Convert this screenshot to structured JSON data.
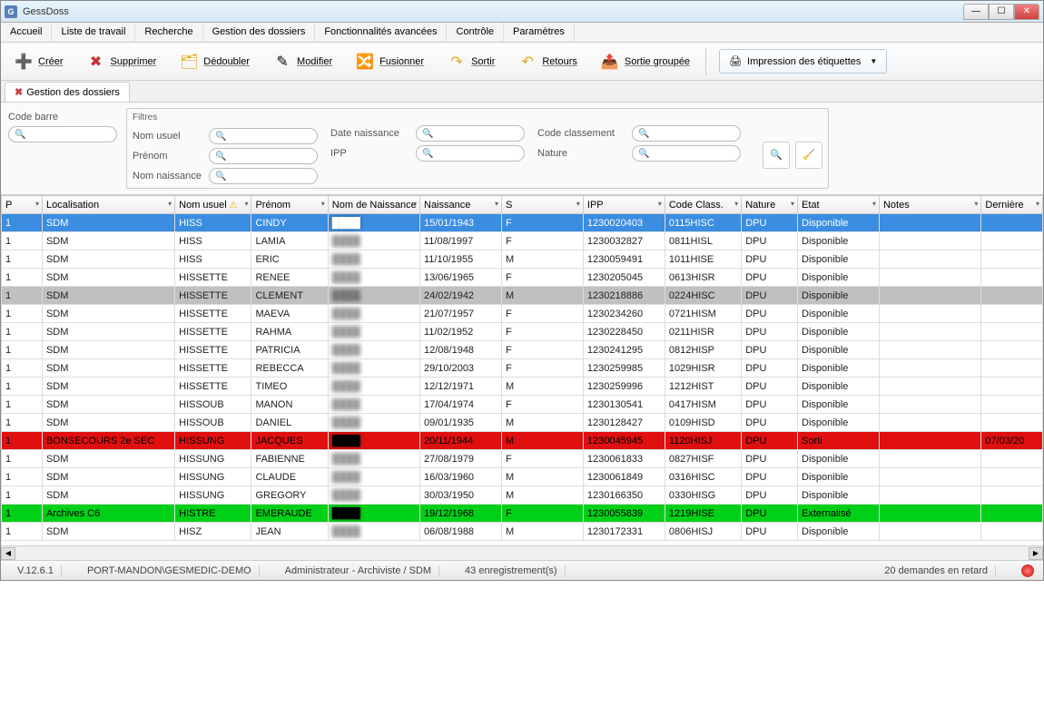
{
  "window": {
    "title": "GessDoss"
  },
  "menu": [
    "Accueil",
    "Liste de travail",
    "Recherche",
    "Gestion des dossiers",
    "Fonctionnalités avancées",
    "Contrôle",
    "Paramètres"
  ],
  "toolbar": {
    "creer": "Créer",
    "supprimer": "Supprimer",
    "dedoubler": "Dédoubler",
    "modifier": "Modifier",
    "fusionner": "Fusionner",
    "sortir": "Sortir",
    "retours": "Retours",
    "sortie_groupee": "Sortie groupée",
    "impression": "Impression des étiquettes"
  },
  "tab": {
    "label": "Gestion des dossiers"
  },
  "filters": {
    "code_barre_label": "Code barre",
    "filtres_label": "Filtres",
    "nom_usuel_label": "Nom usuel",
    "prenom_label": "Prénom",
    "nom_naissance_label": "Nom naissance",
    "date_naissance_label": "Date naissance",
    "ipp_label": "IPP",
    "code_classement_label": "Code classement",
    "nature_label": "Nature"
  },
  "columns": [
    "P",
    "Localisation",
    "Nom usuel",
    "Prénom",
    "Nom de Naissance",
    "Naissance",
    "S",
    "IPP",
    "Code Class.",
    "Nature",
    "Etat",
    "Notes",
    "Dernière"
  ],
  "rows": [
    {
      "p": "1",
      "loc": "SDM",
      "nom": "HISS",
      "prenom": "CINDY",
      "nomn": "",
      "naiss": "15/01/1943",
      "s": "F",
      "ipp": "1230020403",
      "cc": "0115HISC",
      "nat": "DPU",
      "etat": "Disponible",
      "notes": "",
      "dern": "",
      "cls": "row-selected"
    },
    {
      "p": "1",
      "loc": "SDM",
      "nom": "HISS",
      "prenom": "LAMIA",
      "nomn": "",
      "naiss": "11/08/1997",
      "s": "F",
      "ipp": "1230032827",
      "cc": "0811HISL",
      "nat": "DPU",
      "etat": "Disponible",
      "notes": "",
      "dern": "",
      "cls": ""
    },
    {
      "p": "1",
      "loc": "SDM",
      "nom": "HISS",
      "prenom": "ERIC",
      "nomn": "",
      "naiss": "11/10/1955",
      "s": "M",
      "ipp": "1230059491",
      "cc": "1011HISE",
      "nat": "DPU",
      "etat": "Disponible",
      "notes": "",
      "dern": "",
      "cls": ""
    },
    {
      "p": "1",
      "loc": "SDM",
      "nom": "HISSETTE",
      "prenom": "RENEE",
      "nomn": "",
      "naiss": "13/06/1965",
      "s": "F",
      "ipp": "1230205045",
      "cc": "0613HISR",
      "nat": "DPU",
      "etat": "Disponible",
      "notes": "",
      "dern": "",
      "cls": ""
    },
    {
      "p": "1",
      "loc": "SDM",
      "nom": "HISSETTE",
      "prenom": "CLEMENT",
      "nomn": "",
      "naiss": "24/02/1942",
      "s": "M",
      "ipp": "1230218886",
      "cc": "0224HISC",
      "nat": "DPU",
      "etat": "Disponible",
      "notes": "",
      "dern": "",
      "cls": "row-gray"
    },
    {
      "p": "1",
      "loc": "SDM",
      "nom": "HISSETTE",
      "prenom": "MAEVA",
      "nomn": "",
      "naiss": "21/07/1957",
      "s": "F",
      "ipp": "1230234260",
      "cc": "0721HISM",
      "nat": "DPU",
      "etat": "Disponible",
      "notes": "",
      "dern": "",
      "cls": ""
    },
    {
      "p": "1",
      "loc": "SDM",
      "nom": "HISSETTE",
      "prenom": "RAHMA",
      "nomn": "",
      "naiss": "11/02/1952",
      "s": "F",
      "ipp": "1230228450",
      "cc": "0211HISR",
      "nat": "DPU",
      "etat": "Disponible",
      "notes": "",
      "dern": "",
      "cls": ""
    },
    {
      "p": "1",
      "loc": "SDM",
      "nom": "HISSETTE",
      "prenom": "PATRICIA",
      "nomn": "",
      "naiss": "12/08/1948",
      "s": "F",
      "ipp": "1230241295",
      "cc": "0812HISP",
      "nat": "DPU",
      "etat": "Disponible",
      "notes": "",
      "dern": "",
      "cls": ""
    },
    {
      "p": "1",
      "loc": "SDM",
      "nom": "HISSETTE",
      "prenom": "REBECCA",
      "nomn": "",
      "naiss": "29/10/2003",
      "s": "F",
      "ipp": "1230259985",
      "cc": "1029HISR",
      "nat": "DPU",
      "etat": "Disponible",
      "notes": "",
      "dern": "",
      "cls": ""
    },
    {
      "p": "1",
      "loc": "SDM",
      "nom": "HISSETTE",
      "prenom": "TIMEO",
      "nomn": "",
      "naiss": "12/12/1971",
      "s": "M",
      "ipp": "1230259996",
      "cc": "1212HIST",
      "nat": "DPU",
      "etat": "Disponible",
      "notes": "",
      "dern": "",
      "cls": ""
    },
    {
      "p": "1",
      "loc": "SDM",
      "nom": "HISSOUB",
      "prenom": "MANON",
      "nomn": "",
      "naiss": "17/04/1974",
      "s": "F",
      "ipp": "1230130541",
      "cc": "0417HISM",
      "nat": "DPU",
      "etat": "Disponible",
      "notes": "",
      "dern": "",
      "cls": ""
    },
    {
      "p": "1",
      "loc": "SDM",
      "nom": "HISSOUB",
      "prenom": "DANIEL",
      "nomn": "",
      "naiss": "09/01/1935",
      "s": "M",
      "ipp": "1230128427",
      "cc": "0109HISD",
      "nat": "DPU",
      "etat": "Disponible",
      "notes": "",
      "dern": "",
      "cls": ""
    },
    {
      "p": "1",
      "loc": "BONSECOURS 2e SEC",
      "nom": "HISSUNG",
      "prenom": "JACQUES",
      "nomn": "",
      "naiss": "20/11/1944",
      "s": "M",
      "ipp": "1230045945",
      "cc": "1120HISJ",
      "nat": "DPU",
      "etat": "Sorti",
      "notes": "",
      "dern": "07/03/20",
      "cls": "row-red"
    },
    {
      "p": "1",
      "loc": "SDM",
      "nom": "HISSUNG",
      "prenom": "FABIENNE",
      "nomn": "",
      "naiss": "27/08/1979",
      "s": "F",
      "ipp": "1230061833",
      "cc": "0827HISF",
      "nat": "DPU",
      "etat": "Disponible",
      "notes": "",
      "dern": "",
      "cls": ""
    },
    {
      "p": "1",
      "loc": "SDM",
      "nom": "HISSUNG",
      "prenom": "CLAUDE",
      "nomn": "",
      "naiss": "16/03/1960",
      "s": "M",
      "ipp": "1230061849",
      "cc": "0316HISC",
      "nat": "DPU",
      "etat": "Disponible",
      "notes": "",
      "dern": "",
      "cls": ""
    },
    {
      "p": "1",
      "loc": "SDM",
      "nom": "HISSUNG",
      "prenom": "GREGORY",
      "nomn": "",
      "naiss": "30/03/1950",
      "s": "M",
      "ipp": "1230166350",
      "cc": "0330HISG",
      "nat": "DPU",
      "etat": "Disponible",
      "notes": "",
      "dern": "",
      "cls": ""
    },
    {
      "p": "1",
      "loc": "Archives C6",
      "nom": "HISTRE",
      "prenom": "EMERAUDE",
      "nomn": "",
      "naiss": "19/12/1968",
      "s": "F",
      "ipp": "1230055839",
      "cc": "1219HISE",
      "nat": "DPU",
      "etat": "Externalisé",
      "notes": "",
      "dern": "",
      "cls": "row-green"
    },
    {
      "p": "1",
      "loc": "SDM",
      "nom": "HISZ",
      "prenom": "JEAN",
      "nomn": "",
      "naiss": "06/08/1988",
      "s": "M",
      "ipp": "1230172331",
      "cc": "0806HISJ",
      "nat": "DPU",
      "etat": "Disponible",
      "notes": "",
      "dern": "",
      "cls": ""
    }
  ],
  "status": {
    "version": "V.12.6.1",
    "server": "PORT-MANDON\\GESMEDIC-DEMO",
    "user": "Administrateur - Archiviste / SDM",
    "count": "43 enregistrement(s)",
    "late": "20 demandes en retard"
  }
}
